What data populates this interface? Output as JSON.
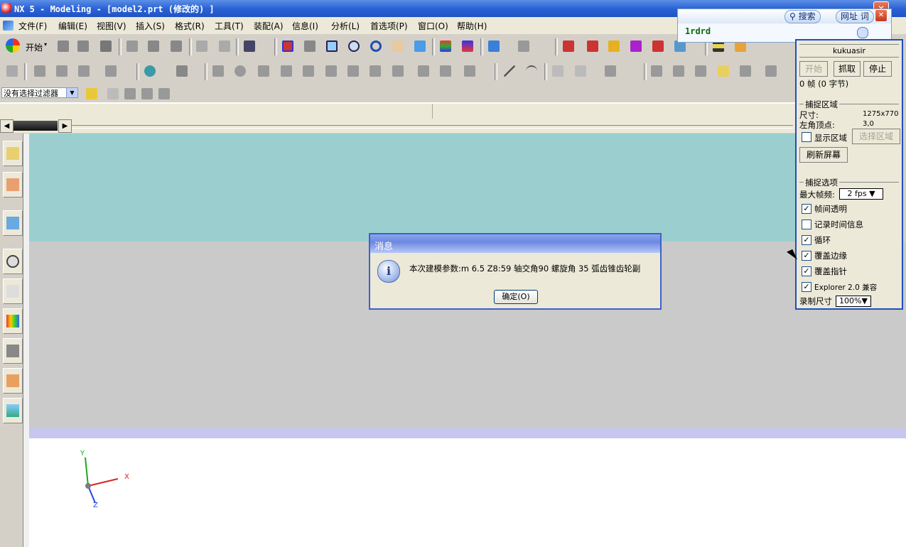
{
  "window": {
    "title": "NX 5 - Modeling - [model2.prt  (修改的) ]"
  },
  "menu": {
    "items": [
      "文件(F)",
      "编辑(E)",
      "视图(V)",
      "插入(S)",
      "格式(R)",
      "工具(T)",
      "装配(A)",
      "信息(I)",
      "分析(L)",
      "首选项(P)",
      "窗口(O)",
      "帮助(H)"
    ]
  },
  "toolbar": {
    "start_label": "开始"
  },
  "filter": {
    "value": "没有选择过滤器"
  },
  "dialog": {
    "title": "消息",
    "message": "本次建模参数:m 6.5 Z8:59  轴交角90 螺旋角 35 弧齿锥齿轮副",
    "ok_label": "确定(O)"
  },
  "triad": {
    "x": "X",
    "y": "Y",
    "z": "Z"
  },
  "addressbar": {
    "search_label": "搜索",
    "url_label": "网址",
    "ci_label": "词",
    "value": "1rdrd"
  },
  "capture_panel": {
    "user": "kukuasir",
    "start_label": "开始",
    "grab_label": "抓取",
    "stop_label": "停止",
    "frames_text": "0 帧 (0 字节)",
    "region_group": "捕捉区域",
    "size_label": "尺寸:",
    "size_value": "1275x770",
    "origin_label": "左角顶点:",
    "origin_value": "3,0",
    "show_region_label": "显示区域",
    "select_region_label": "选择区域",
    "refresh_label": "刷新屏幕",
    "options_group": "捕捉选项",
    "fps_label": "最大帧频:",
    "fps_value": "2 fps",
    "transparent_label": "帧间透明",
    "timeinfo_label": "记录时间信息",
    "loop_label": "循环",
    "cover_edge_label": "覆盖边缘",
    "cover_pointer_label": "覆盖指针",
    "explorer_label": "Explorer 2.0 兼容",
    "record_size_label": "录制尺寸",
    "record_size_value": "100%"
  }
}
